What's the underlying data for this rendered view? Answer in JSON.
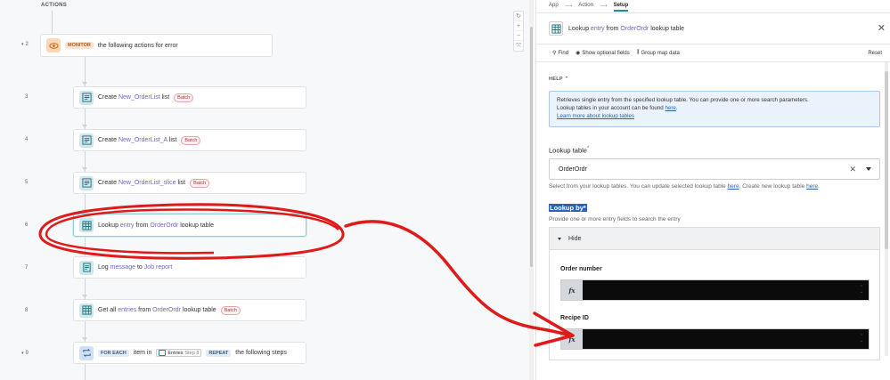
{
  "canvas": {
    "section_label": "ACTIONS",
    "zoom_controls": [
      "↻",
      "+",
      "−",
      "⤧"
    ],
    "steps": [
      {
        "num": "2",
        "pre": "",
        "kw": "",
        "mid": "the following actions for error",
        "kw2": "",
        "post": "",
        "badge": "",
        "pill": "MONITOR"
      },
      {
        "num": "3",
        "pre": "Create ",
        "kw": "New_OrderList",
        "mid": " list",
        "kw2": "",
        "post": "",
        "badge": "Batch"
      },
      {
        "num": "4",
        "pre": "Create ",
        "kw": "New_OrderList_A",
        "mid": " list",
        "kw2": "",
        "post": "",
        "badge": "Batch"
      },
      {
        "num": "5",
        "pre": "Create ",
        "kw": "New_OrderList_slice",
        "mid": " list",
        "kw2": "",
        "post": "",
        "badge": "Batch"
      },
      {
        "num": "6",
        "pre": "Lookup ",
        "kw": "entry",
        "mid": " from ",
        "kw2": "OrderOrdr",
        "post": " lookup table",
        "badge": ""
      },
      {
        "num": "7",
        "pre": "Log ",
        "kw": "message",
        "mid": " to ",
        "kw2": "Job report",
        "post": "",
        "badge": ""
      },
      {
        "num": "8",
        "pre": "Get all ",
        "kw": "entries",
        "mid": " from ",
        "kw2": "OrderOrdr",
        "post": " lookup table",
        "badge": "Batch"
      },
      {
        "num": "9",
        "for_each": "FOR EACH",
        "item_in": "item in",
        "datapill": "Entries",
        "stepref": "Step 8",
        "repeat": "REPEAT",
        "post": "the following steps"
      }
    ]
  },
  "panel": {
    "breadcrumbs": [
      "App",
      "Action",
      "Setup"
    ],
    "header_pre": "Lookup ",
    "header_kw": "entry",
    "header_mid": " from ",
    "header_kw2": "OrderOrdr",
    "header_post": " lookup table",
    "toolbar": {
      "find": "Find",
      "optional": "Show optional fields",
      "group": "Group map data",
      "reset": "Reset"
    },
    "help": {
      "title": "HELP",
      "line1": "Retrieves single entry from the specified lookup table. You can provide one or more search parameters.",
      "line2_pre": "Lookup tables in your account can be found ",
      "line2_link": "here",
      "line2_post": ".",
      "line3_link": "Learn more about lookup tables"
    },
    "lookup_table": {
      "label": "Lookup table",
      "required": "*",
      "value": "OrderOrdr",
      "hint_pre": "Select from your lookup tables. You can update selected lookup table ",
      "hint_link1": "here",
      "hint_mid": ". Create new lookup table ",
      "hint_link2": "here",
      "hint_post": "."
    },
    "lookup_by": {
      "label": "Lookup by",
      "required": "*",
      "hint": "Provide one or more entry fields to search the entry",
      "toggle": "Hide",
      "fields": [
        {
          "label": "Order number"
        },
        {
          "label": "Recipe ID"
        }
      ]
    }
  },
  "colors": {
    "accent": "#1a8e97",
    "annotation": "#e01919",
    "link": "#2a62b8",
    "badge": "#9b3b3b"
  }
}
